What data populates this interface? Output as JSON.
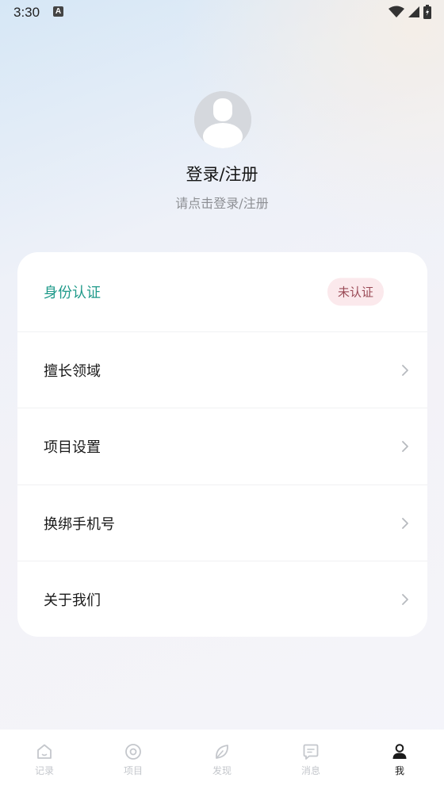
{
  "status_bar": {
    "time": "3:30",
    "notification_icon_letter": "A"
  },
  "profile": {
    "title": "登录/注册",
    "subtitle": "请点击登录/注册"
  },
  "menu": {
    "identity": {
      "label": "身份认证",
      "badge": "未认证"
    },
    "items": [
      {
        "label": "擅长领域"
      },
      {
        "label": "项目设置"
      },
      {
        "label": "换绑手机号"
      },
      {
        "label": "关于我们"
      }
    ]
  },
  "bottom_nav": {
    "items": [
      {
        "label": "记录",
        "icon": "home-icon"
      },
      {
        "label": "项目",
        "icon": "target-icon"
      },
      {
        "label": "发现",
        "icon": "leaf-icon"
      },
      {
        "label": "消息",
        "icon": "message-icon"
      },
      {
        "label": "我",
        "icon": "person-icon"
      }
    ],
    "active_index": 4
  },
  "colors": {
    "accent": "#1f9a8a",
    "badge_bg": "#fbe9ec",
    "badge_text": "#9a4a56",
    "nav_inactive": "#c4c7cc",
    "nav_active": "#1a1a1a"
  }
}
